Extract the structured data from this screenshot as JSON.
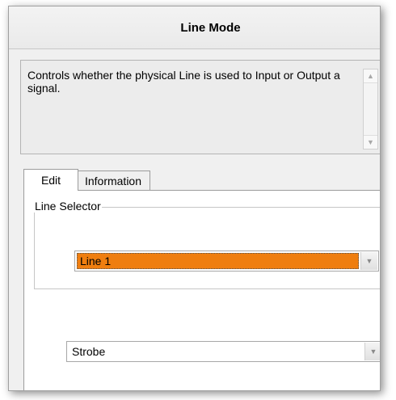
{
  "panel": {
    "title": "Line Mode",
    "description": "Controls whether the physical Line is used to Input or Output a signal."
  },
  "tabs": [
    {
      "label": "Edit",
      "active": true
    },
    {
      "label": "Information",
      "active": false
    }
  ],
  "edit": {
    "group_label": "Line Selector",
    "line_selector_value": "Line 1",
    "line_selector_highlight": "#ef7e0f",
    "mode_value": "Strobe"
  }
}
